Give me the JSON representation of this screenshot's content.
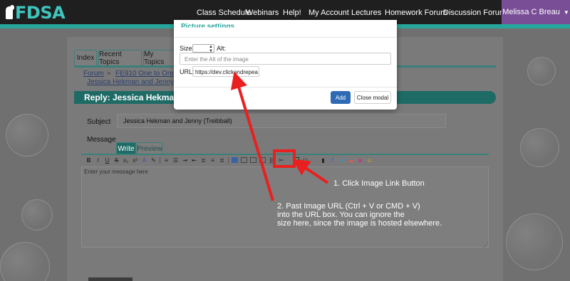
{
  "brand": {
    "logo_text": "FDSA",
    "accent": "#3fc5bd",
    "user_color": "#7a4e96"
  },
  "nav": {
    "items": [
      "Class Schedule",
      "Webinars",
      "Help!",
      "My Account",
      "Lectures",
      "Homework Forum",
      "Discussion Forum"
    ],
    "user": "Melissa C Breau"
  },
  "forum": {
    "tabs": [
      "Index",
      "Recent Topics",
      "My Topics"
    ],
    "breadcrumb": [
      "Forum",
      "FE910 One to One wit",
      "Jessica Hekman and Jenny (Treib"
    ],
    "reply_title": "Reply: Jessica Hekman a",
    "subject_label": "Subject",
    "subject_value": "Jessica Hekman and Jenny (Treibball)",
    "message_label": "Message",
    "write_tab": "Write",
    "preview_tab": "Preview",
    "editor_placeholder": "Enter your message here"
  },
  "modal": {
    "title": "Picture settings",
    "size_label": "Size:",
    "alt_label": "Alt:",
    "alt_placeholder": "Enter the Alt of the image",
    "url_label": "URL:",
    "url_value": "https://dev.clickandrepea",
    "add_button": "Add",
    "close_button": "Close modal"
  },
  "annotations": {
    "step1": "1. Click Image Link Button",
    "step2_lines": [
      "2. Past Image URL (Ctrl + V or CMD + V)",
      "into the URL box. You can ignore the",
      "size here, since the image is hosted elsewhere."
    ],
    "arrow_color": "#e8201f"
  }
}
